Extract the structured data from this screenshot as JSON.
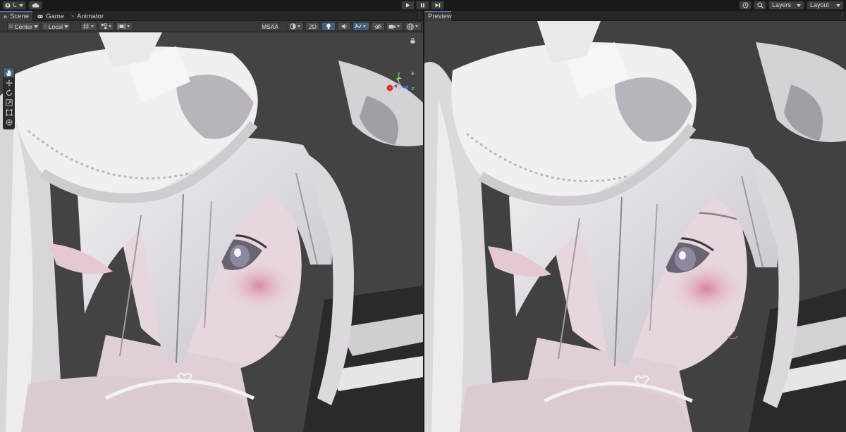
{
  "toolbar": {
    "account_label": "L",
    "layers_label": "Layers",
    "layout_label": "Layout"
  },
  "tabs": {
    "scene": "Scene",
    "game": "Game",
    "animator": "Animator",
    "preview": "Preview"
  },
  "scene_toolbar": {
    "pivot_label": "Center",
    "space_label": "Local",
    "msaa_label": "MSAA",
    "twod_label": "2D"
  },
  "gizmo": {
    "y_label": "y",
    "z_label": "z"
  },
  "colors": {
    "accent": "#46607c",
    "viewport_bg": "#444444",
    "skin": "#e8d8de",
    "blush": "#d88aa8",
    "hair": "#e8e4ea"
  }
}
